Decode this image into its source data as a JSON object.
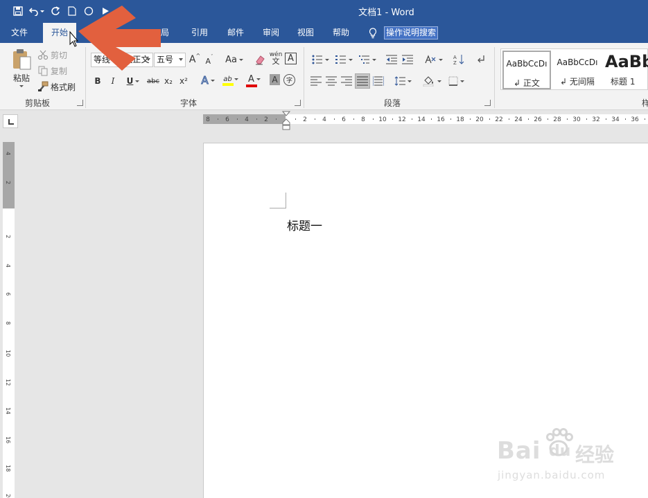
{
  "window": {
    "title": "文档1  -  Word"
  },
  "tabs": [
    {
      "label": "文件",
      "active": false
    },
    {
      "label": "开始",
      "active": true
    },
    {
      "label": "局",
      "active": false
    },
    {
      "label": "引用",
      "active": false
    },
    {
      "label": "邮件",
      "active": false
    },
    {
      "label": "审阅",
      "active": false
    },
    {
      "label": "视图",
      "active": false
    },
    {
      "label": "帮助",
      "active": false
    }
  ],
  "tell_me": {
    "label": "操作说明搜索",
    "icon": "lightbulb-icon"
  },
  "clipboard": {
    "paste": "粘贴",
    "cut": "剪切",
    "copy": "复制",
    "format_painter": "格式刷",
    "group_label": "剪贴板"
  },
  "font": {
    "font_name": "等线 (中文正文",
    "font_size": "五号",
    "group_label": "字体",
    "change_case": "Aa",
    "grow": "A",
    "shrink": "A",
    "bold": "B",
    "italic": "I",
    "underline": "U",
    "strike": "abc",
    "subscript": "x₂",
    "superscript": "x²",
    "text_effects": "A",
    "highlight": "ab",
    "font_color": "A",
    "char_shading": "A",
    "enclose": "字",
    "phonetic": "wén",
    "char_border": "A"
  },
  "paragraph": {
    "group_label": "段落"
  },
  "styles": {
    "items": [
      {
        "preview": "AaBbCcDı",
        "name": "正文"
      },
      {
        "preview": "AaBbCcDı",
        "name": "无间隔"
      },
      {
        "preview": "AaBb",
        "name": "标题 1"
      }
    ],
    "group_label": "样"
  },
  "ruler": {
    "left_ticks": [
      "8",
      "6",
      "4",
      "2"
    ],
    "right_ticks": [
      "2",
      "4",
      "6",
      "8",
      "10",
      "12",
      "14",
      "16",
      "18",
      "20",
      "22",
      "24",
      "26",
      "28",
      "30",
      "32",
      "34",
      "36"
    ],
    "vertical_top": [
      "4",
      "2"
    ],
    "vertical_ticks": [
      "2",
      "4",
      "6",
      "8",
      "10",
      "12",
      "14",
      "16",
      "18",
      "20"
    ]
  },
  "document": {
    "text": "标题一"
  },
  "watermark": {
    "brand": "Bai",
    "brand2": "du",
    "brand_cn": "经验",
    "url": "jingyan.baidu.com"
  },
  "colors": {
    "ribbon_blue": "#2b579a",
    "arrow": "#e2603e",
    "highlight": "#ffff00",
    "font_red": "#e00000"
  }
}
